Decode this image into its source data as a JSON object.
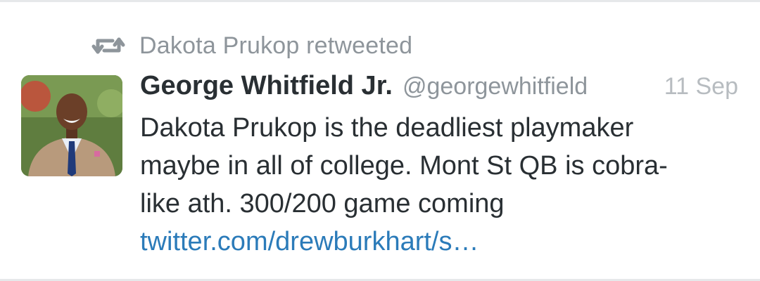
{
  "retweet": {
    "icon": "retweet-icon",
    "text": "Dakota Prukop retweeted"
  },
  "tweet": {
    "avatar_icon": "avatar-photo",
    "author_name": "George Whitfield Jr.",
    "author_handle": "@georgewhitfield",
    "timestamp": "11 Sep",
    "text_lines": [
      "Dakota Prukop is the deadliest playmaker",
      "maybe in all of college. Mont St QB is cobra-",
      "like ath. 300/200 game coming"
    ],
    "link_text": "twitter.com/drewburkhart/s…"
  },
  "colors": {
    "link": "#2b7bb9",
    "secondary_text": "#8e959b",
    "primary_text": "#292f33"
  }
}
